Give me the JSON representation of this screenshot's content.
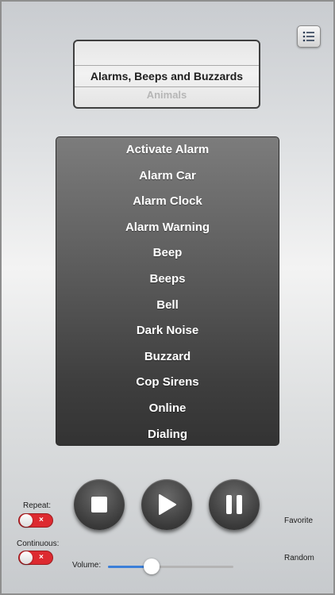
{
  "colors": {
    "toggle_off": "#dd2a30",
    "slider_fill": "#3b7fd8",
    "list_text": "#ffffff"
  },
  "header": {
    "list_button_icon": "list-icon"
  },
  "picker": {
    "selected": "Alarms, Beeps and Buzzards",
    "next": "Animals"
  },
  "sounds": [
    "Activate Alarm",
    "Alarm Car",
    "Alarm Clock",
    "Alarm Warning",
    "Beep",
    "Beeps",
    "Bell",
    "Dark Noise",
    "Buzzard",
    "Cop Sirens",
    "Online",
    "Dialing"
  ],
  "controls": {
    "stop_icon": "stop-icon",
    "play_icon": "play-icon",
    "pause_icon": "pause-icon"
  },
  "options": {
    "repeat_label": "Repeat:",
    "repeat_state": "×",
    "continuous_label": "Continuous:",
    "continuous_state": "×",
    "volume_label": "Volume:",
    "volume_level": 0.35,
    "favorite_label": "Favorite",
    "random_label": "Random"
  }
}
